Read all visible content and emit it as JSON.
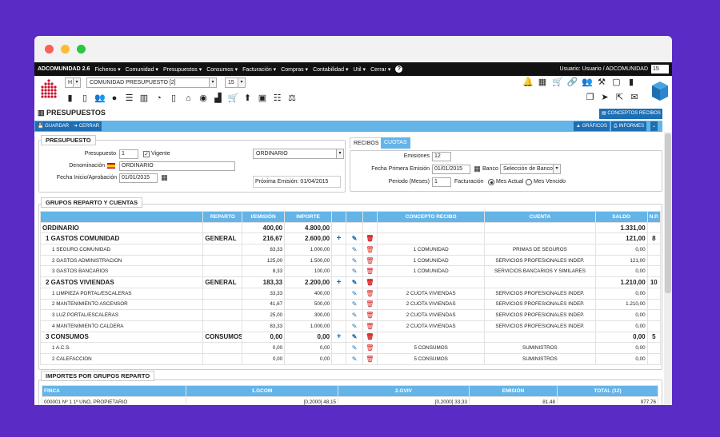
{
  "menubar": {
    "app": "ADCOMUNIDAD 2.6",
    "items": [
      "Ficheros",
      "Comunidad",
      "Presupuestos",
      "Consumos",
      "Facturación",
      "Compras",
      "Contabilidad",
      "Util",
      "Cerrar"
    ],
    "user": "Usuario: Usuario / ADCOMUNIDAD",
    "user_select": "15"
  },
  "topbar": {
    "type_select": "H",
    "community_select": "COMUNIDAD PRESUPUESTO [2]",
    "number_select": "15"
  },
  "icons_right_row1": [
    "bell-icon",
    "calendar-icon",
    "cart-icon",
    "link-icon",
    "users-icon",
    "gavel-icon",
    "page-icon",
    "file-icon"
  ],
  "icons_right_row2": [
    "copy-icon",
    "send-icon",
    "external-icon",
    "mail-icon"
  ],
  "icons_row2": [
    "book-icon",
    "notebook-icon",
    "users-icon",
    "user-icon",
    "list-icon",
    "barchart-icon",
    "gauge-icon",
    "scroll-icon",
    "bank-icon",
    "target-icon",
    "factory-icon",
    "cart-icon",
    "arrow-up-icon",
    "money-icon",
    "listnum-icon",
    "scale-icon"
  ],
  "page_title": "PRESUPUESTOS",
  "conceptos_btn": "CONCEPTOS RECIBOS",
  "toolbar": {
    "guardar": "GUARDAR",
    "cerrar": "CERRAR",
    "graficos": "GRÁFICOS",
    "informes": "INFORMES"
  },
  "presupuesto": {
    "legend": "PRESUPUESTO",
    "presupuesto_label": "Presupuesto",
    "presupuesto_value": "1",
    "vigente_label": "Vigente",
    "denominacion_label": "Denominación",
    "denominacion_value": "ORDINARIO",
    "fecha_label": "Fecha Inicio/Aprobación",
    "fecha_value": "01/01/2015",
    "tipo_select": "ORDINARIO",
    "proxima": "Próxima Emisión: 01/04/2015"
  },
  "recibos": {
    "tab1": "RECIBOS",
    "tab2": "CUOTAS",
    "emisiones_label": "Emisiones",
    "emisiones_value": "12",
    "fecha_label": "Fecha Primera Emisión",
    "fecha_value": "01/01/2015",
    "banco_label": "Banco",
    "banco_select": "Selección de Banco",
    "periodo_label": "Periodo (Meses)",
    "periodo_value": "1",
    "facturacion_label": "Facturación",
    "opt1": "Mes Actual",
    "opt2": "Mes Vencido"
  },
  "grupos": {
    "legend": "GRUPOS REPARTO Y CUENTAS",
    "headers": [
      "",
      "REPARTO",
      "I/EMISIÓN",
      "IMPORTE",
      "",
      "",
      "",
      "CONCEPTO RECIBO",
      "CUENTA",
      "SALDO",
      "N.P."
    ],
    "rows": [
      {
        "name": "ORDINARIO",
        "reparto": "",
        "emision": "400,00",
        "importe": "4.800,00",
        "plus": false,
        "tools": false,
        "concepto": "",
        "cuenta": "",
        "saldo": "1.331,00",
        "np": "",
        "bold": true
      },
      {
        "name": "1 GASTOS COMUNIDAD",
        "reparto": "GENERAL",
        "emision": "216,67",
        "importe": "2.600,00",
        "plus": true,
        "tools": true,
        "concepto": "",
        "cuenta": "",
        "saldo": "121,00",
        "np": "8",
        "bold": true
      },
      {
        "name": "1 SEGURO COMUNIDAD",
        "reparto": "",
        "emision": "83,33",
        "importe": "1.000,00",
        "plus": false,
        "tools": true,
        "concepto": "1 COMUNIDAD",
        "cuenta": "PRIMAS DE SEGUROS",
        "saldo": "0,00",
        "np": "",
        "bold": false
      },
      {
        "name": "2 GASTOS ADMINISTRACION",
        "reparto": "",
        "emision": "125,00",
        "importe": "1.500,00",
        "plus": false,
        "tools": true,
        "concepto": "1 COMUNIDAD",
        "cuenta": "SERVICIOS PROFESIONALES INDEP.",
        "saldo": "121,00",
        "np": "",
        "bold": false
      },
      {
        "name": "3 GASTOS BANCARIOS",
        "reparto": "",
        "emision": "8,33",
        "importe": "100,00",
        "plus": false,
        "tools": true,
        "concepto": "1 COMUNIDAD",
        "cuenta": "SERVICIOS BANCARIOS Y SIMILARES",
        "saldo": "0,00",
        "np": "",
        "bold": false
      },
      {
        "name": "2 GASTOS VIVIENDAS",
        "reparto": "GENERAL",
        "emision": "183,33",
        "importe": "2.200,00",
        "plus": true,
        "tools": true,
        "concepto": "",
        "cuenta": "",
        "saldo": "1.210,00",
        "np": "10",
        "bold": true
      },
      {
        "name": "1 LIMPIEZA PORTAL/ESCALERAS",
        "reparto": "",
        "emision": "33,33",
        "importe": "400,00",
        "plus": false,
        "tools": true,
        "concepto": "2 CUOTA VIVIENDAS",
        "cuenta": "SERVICIOS PROFESIONALES INDEP.",
        "saldo": "0,00",
        "np": "",
        "bold": false
      },
      {
        "name": "2 MANTENIMIENTO ASCENSOR",
        "reparto": "",
        "emision": "41,67",
        "importe": "500,00",
        "plus": false,
        "tools": true,
        "concepto": "2 CUOTA VIVIENDAS",
        "cuenta": "SERVICIOS PROFESIONALES INDEP.",
        "saldo": "1.210,00",
        "np": "",
        "bold": false
      },
      {
        "name": "3 LUZ PORTAL/ESCALERAS",
        "reparto": "",
        "emision": "25,00",
        "importe": "300,00",
        "plus": false,
        "tools": true,
        "concepto": "2 CUOTA VIVIENDAS",
        "cuenta": "SERVICIOS PROFESIONALES INDEP.",
        "saldo": "0,00",
        "np": "",
        "bold": false
      },
      {
        "name": "4 MANTENIMIENTO CALDERA",
        "reparto": "",
        "emision": "83,33",
        "importe": "1.000,00",
        "plus": false,
        "tools": true,
        "concepto": "2 CUOTA VIVIENDAS",
        "cuenta": "SERVICIOS PROFESIONALES INDEP.",
        "saldo": "0,00",
        "np": "",
        "bold": false
      },
      {
        "name": "3 CONSUMOS",
        "reparto": "CONSUMOS",
        "emision": "0,00",
        "importe": "0,00",
        "plus": true,
        "tools": true,
        "concepto": "",
        "cuenta": "",
        "saldo": "0,00",
        "np": "5",
        "bold": true
      },
      {
        "name": "1 A.C.S.",
        "reparto": "",
        "emision": "0,00",
        "importe": "0,00",
        "plus": false,
        "tools": true,
        "concepto": "5 CONSUMOS",
        "cuenta": "SUMINISTROS",
        "saldo": "0,00",
        "np": "",
        "bold": false
      },
      {
        "name": "2 CALEFACCION",
        "reparto": "",
        "emision": "0,00",
        "importe": "0,00",
        "plus": false,
        "tools": true,
        "concepto": "5 CONSUMOS",
        "cuenta": "SUMINISTROS",
        "saldo": "0,00",
        "np": "",
        "bold": false
      }
    ]
  },
  "importes": {
    "legend": "IMPORTES POR GRUPOS REPARTO",
    "headers": [
      "FINCA",
      "1.GCOM",
      "2.GVIV",
      "EMISIÓN",
      "TOTAL (12)"
    ],
    "rows": [
      {
        "finca": "000001 Nº 1 1º UNO, PROPIETARIO",
        "gcom": "[0,2000] 48,15",
        "gviv": "[0,2000] 33,33",
        "emision": "81,48",
        "total": "977,76"
      }
    ]
  }
}
